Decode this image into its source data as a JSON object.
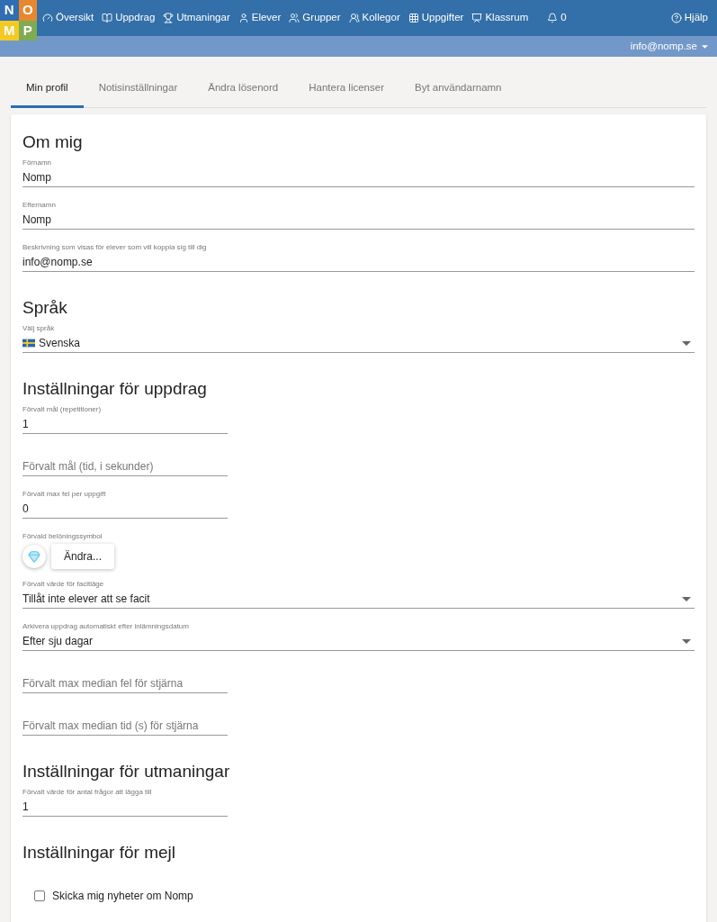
{
  "nav": {
    "logo": [
      "N",
      "O",
      "M",
      "P"
    ],
    "items": [
      "Översikt",
      "Uppdrag",
      "Utmaningar",
      "Elever",
      "Grupper",
      "Kollegor",
      "Uppgifter",
      "Klassrum",
      "0"
    ],
    "help": "Hjälp"
  },
  "account": "info@nomp.se",
  "tabs": [
    {
      "label": "Min profil",
      "selected": true
    },
    {
      "label": "Notisinställningar",
      "selected": false
    },
    {
      "label": "Ändra lösenord",
      "selected": false
    },
    {
      "label": "Hantera licenser",
      "selected": false
    },
    {
      "label": "Byt användarnamn",
      "selected": false
    }
  ],
  "sections": [
    {
      "title": "Om mig",
      "fields": [
        {
          "kind": "text",
          "label": "Förnamn",
          "value": "Nomp"
        },
        {
          "kind": "text",
          "label": "Efternamn",
          "value": "Nomp"
        },
        {
          "kind": "text",
          "label": "Beskrivning som visas för elever som vill koppla sig till dig",
          "value": "info@nomp.se"
        }
      ]
    },
    {
      "title": "Språk",
      "fields": [
        {
          "kind": "language",
          "label": "Välj språk",
          "value": "Svenska"
        }
      ]
    },
    {
      "title": "Inställningar för uppdrag",
      "fields": [
        {
          "kind": "short",
          "label": "Förvalt mål (repetitioner)",
          "value": "1"
        },
        {
          "kind": "short",
          "placeholder": "Förvalt mål (tid, i sekunder)"
        },
        {
          "kind": "short",
          "label": "Förvalt max fel per uppgift",
          "value": "0"
        },
        {
          "kind": "reward",
          "label": "Förvald belöningssymbol",
          "button": "Ändra..."
        },
        {
          "kind": "select",
          "label": "Förvalt värde för facitläge",
          "value": "Tillåt inte elever att se facit"
        },
        {
          "kind": "select",
          "label": "Arkivera uppdrag automatiskt efter inlämningsdatum",
          "value": "Efter sju dagar"
        },
        {
          "kind": "short",
          "placeholder": "Förvalt max median fel för stjärna"
        },
        {
          "kind": "short",
          "placeholder": "Förvalt max median tid (s) för stjärna"
        }
      ]
    },
    {
      "title": "Inställningar för utmaningar",
      "fields": [
        {
          "kind": "short",
          "label": "Förvalt värde för antal frågor att lägga till",
          "value": "1"
        }
      ]
    },
    {
      "title": "Inställningar för mejl",
      "fields": [
        {
          "kind": "checkbox",
          "label": "Skicka mig nyheter om Nomp",
          "checked": false
        }
      ]
    }
  ]
}
